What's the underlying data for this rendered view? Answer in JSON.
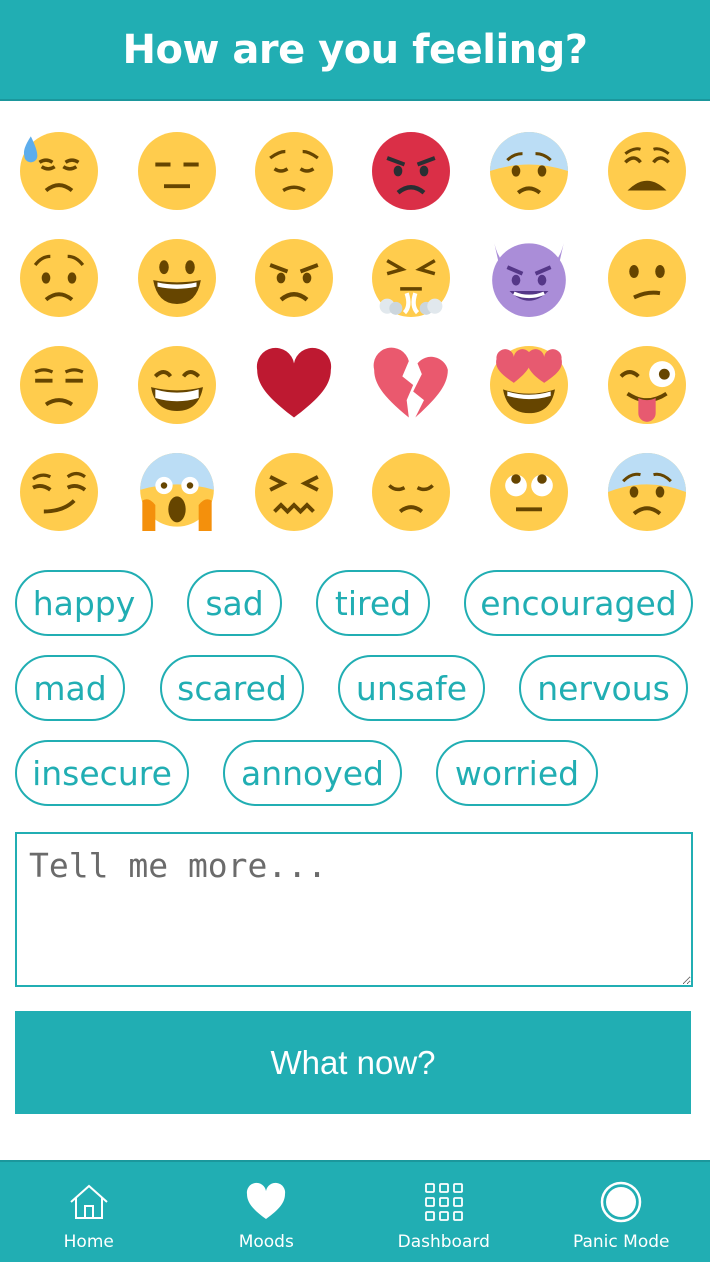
{
  "header": {
    "title": "How are you feeling?"
  },
  "emojis": [
    "downcast-sweat-icon",
    "expressionless-icon",
    "pensive-icon",
    "pouting-red-icon",
    "anxious-cold-icon",
    "weary-icon",
    "worried-icon",
    "smiley-icon",
    "angry-icon",
    "triumph-steam-icon",
    "smiling-imp-icon",
    "confused-icon",
    "unamused-icon",
    "grin-icon",
    "red-heart-icon",
    "broken-heart-icon",
    "heart-eyes-icon",
    "winking-tongue-icon",
    "smirk-icon",
    "scream-icon",
    "confounded-icon",
    "disappointed-icon",
    "eye-roll-icon",
    "fearful-icon"
  ],
  "moods": [
    {
      "label": "happy"
    },
    {
      "label": "sad"
    },
    {
      "label": "tired"
    },
    {
      "label": "encouraged"
    },
    {
      "label": "mad"
    },
    {
      "label": "scared"
    },
    {
      "label": "unsafe"
    },
    {
      "label": "nervous"
    },
    {
      "label": "insecure"
    },
    {
      "label": "annoyed"
    },
    {
      "label": "worried"
    }
  ],
  "note": {
    "placeholder": "Tell me more..."
  },
  "submit": {
    "label": "What now?"
  },
  "nav": [
    {
      "label": "Home",
      "icon": "home-icon"
    },
    {
      "label": "Moods",
      "icon": "heart-icon"
    },
    {
      "label": "Dashboard",
      "icon": "grid-icon"
    },
    {
      "label": "Panic Mode",
      "icon": "panic-circle-icon"
    }
  ],
  "colors": {
    "accent": "#21aeb3",
    "emoji_yellow": "#ffcc4d",
    "angry_red": "#da2f47",
    "heart_red": "#be1931",
    "broken_heart_pink": "#ea596e",
    "imp_purple": "#aa8dd8"
  }
}
